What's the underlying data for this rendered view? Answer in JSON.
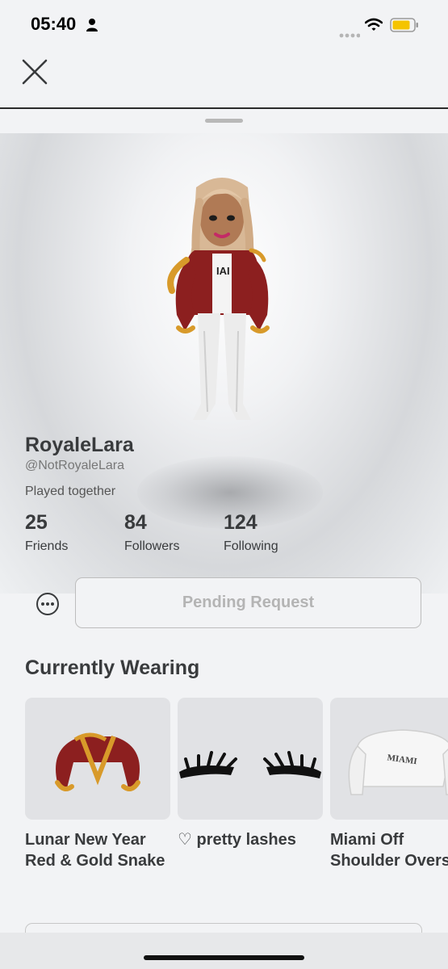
{
  "status_bar": {
    "time": "05:40",
    "person_icon": "person-icon",
    "wifi_icon": "wifi-icon",
    "battery_icon": "battery-icon",
    "battery_color": "#f5c400"
  },
  "nav": {
    "close_icon": "close-icon"
  },
  "profile": {
    "display_name": "RoyaleLara",
    "username": "@NotRoyaleLara",
    "relation": "Played together",
    "stats": [
      {
        "value": "25",
        "label": "Friends"
      },
      {
        "value": "84",
        "label": "Followers"
      },
      {
        "value": "124",
        "label": "Following"
      }
    ]
  },
  "actions": {
    "more_icon": "more-options-icon",
    "pending_label": "Pending Request"
  },
  "wearing": {
    "title": "Currently Wearing",
    "items": [
      {
        "name": "Lunar New Year\nRed & Gold Snake",
        "icon": "jacket-thumbnail"
      },
      {
        "name": "♡ pretty lashes",
        "icon": "lashes-thumbnail"
      },
      {
        "name": "Miami Off\nShoulder Overs",
        "icon": "sweater-thumbnail"
      }
    ]
  },
  "colors": {
    "background": "#f2f3f5",
    "text_primary": "#393b3d",
    "button_disabled_text": "#b4b4b4"
  }
}
